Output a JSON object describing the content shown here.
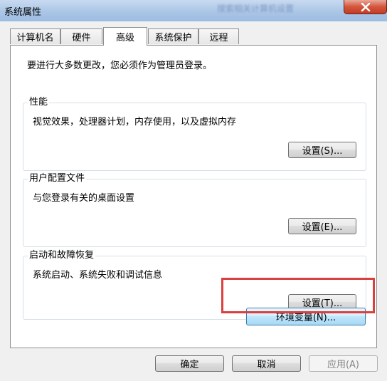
{
  "window": {
    "title": "系统属性",
    "background_title": "搜索相关计算机设置"
  },
  "tabs": [
    {
      "label": "计算机名",
      "active": false
    },
    {
      "label": "硬件",
      "active": false
    },
    {
      "label": "高级",
      "active": true
    },
    {
      "label": "系统保护",
      "active": false
    },
    {
      "label": "远程",
      "active": false
    }
  ],
  "advanced": {
    "admin_note": "要进行大多数更改，您必须作为管理员登录。",
    "performance": {
      "title": "性能",
      "description": "视觉效果，处理器计划，内存使用，以及虚拟内存",
      "button": "设置(S)..."
    },
    "user_profiles": {
      "title": "用户配置文件",
      "description": "与您登录有关的桌面设置",
      "button": "设置(E)..."
    },
    "startup_recovery": {
      "title": "启动和故障恢复",
      "description": "系统启动、系统失败和调试信息",
      "button": "设置(T)..."
    },
    "env_button": "环境变量(N)..."
  },
  "footer": {
    "ok": "确定",
    "cancel": "取消",
    "apply": "应用(A)"
  },
  "colors": {
    "highlight_box": "#d94040",
    "close_button": "#c43c24"
  }
}
